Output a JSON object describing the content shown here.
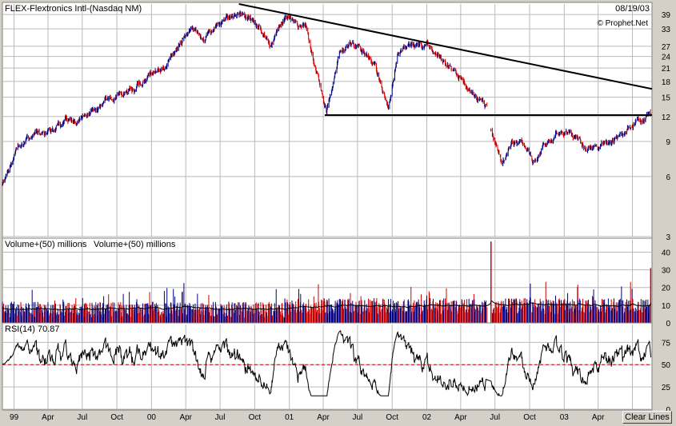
{
  "header": {
    "title": "FLEX-Flextronics Intl-(Nasdaq NM)",
    "date": "08/19/03",
    "watermark": "© Prophet.Net"
  },
  "buttons": {
    "clear_lines": "Clear Lines"
  },
  "colors": {
    "up": "#000080",
    "down": "#cc0000",
    "trendline": "#000000",
    "rsi_reference": "#cc0000",
    "panel_bg": "#ffffff",
    "frame": "#d4d0c8"
  },
  "chart_data": [
    {
      "type": "line",
      "name": "price",
      "title": "FLEX-Flextronics Intl-(Nasdaq NM)",
      "y_scale": "log",
      "yticks": [
        3,
        6,
        9,
        12,
        15,
        18,
        21,
        24,
        27,
        33,
        39
      ],
      "ylim": [
        3,
        44
      ],
      "xlim": [
        "1998-12-01",
        "2003-08-22"
      ],
      "x_ticks": [
        {
          "date": "1999-01-01",
          "label": "99"
        },
        {
          "date": "1999-04-01",
          "label": "Apr"
        },
        {
          "date": "1999-07-01",
          "label": "Jul"
        },
        {
          "date": "1999-10-01",
          "label": "Oct"
        },
        {
          "date": "2000-01-01",
          "label": "00"
        },
        {
          "date": "2000-04-01",
          "label": "Apr"
        },
        {
          "date": "2000-07-01",
          "label": "Jul"
        },
        {
          "date": "2000-10-01",
          "label": "Oct"
        },
        {
          "date": "2001-01-01",
          "label": "01"
        },
        {
          "date": "2001-04-01",
          "label": "Apr"
        },
        {
          "date": "2001-07-01",
          "label": "Jul"
        },
        {
          "date": "2001-10-01",
          "label": "Oct"
        },
        {
          "date": "2002-01-01",
          "label": "02"
        },
        {
          "date": "2002-04-01",
          "label": "Apr"
        },
        {
          "date": "2002-07-01",
          "label": "Jul"
        },
        {
          "date": "2002-10-01",
          "label": "Oct"
        },
        {
          "date": "2003-01-01",
          "label": "03"
        },
        {
          "date": "2003-04-01",
          "label": "Apr"
        },
        {
          "date": "2003-07-01",
          "label": "Jul"
        }
      ],
      "x": [
        "1998-12-01",
        "1999-01-15",
        "1999-03-01",
        "1999-04-15",
        "1999-05-15",
        "1999-06-15",
        "1999-08-01",
        "1999-09-15",
        "1999-11-01",
        "1999-12-15",
        "2000-01-15",
        "2000-03-01",
        "2000-04-15",
        "2000-05-15",
        "2000-07-01",
        "2000-08-20",
        "2000-09-15",
        "2000-10-15",
        "2000-11-15",
        "2000-12-15",
        "2001-01-15",
        "2001-02-15",
        "2001-03-20",
        "2001-04-10",
        "2001-05-15",
        "2001-06-15",
        "2001-07-15",
        "2001-08-15",
        "2001-09-20",
        "2001-10-15",
        "2001-11-15",
        "2001-12-15",
        "2002-01-15",
        "2002-02-15",
        "2002-03-15",
        "2002-04-15",
        "2002-05-15",
        "2002-06-10",
        "2002-06-20",
        "2002-07-20",
        "2002-08-15",
        "2002-09-15",
        "2002-10-10",
        "2002-11-15",
        "2002-12-15",
        "2003-01-15",
        "2003-02-15",
        "2003-03-15",
        "2003-04-15",
        "2003-05-15",
        "2003-06-15",
        "2003-07-15",
        "2003-08-19"
      ],
      "close": [
        5.5,
        8.5,
        9.5,
        10.5,
        11.5,
        11.5,
        13,
        15,
        16,
        19,
        20,
        25,
        33,
        29,
        35,
        40,
        37,
        33,
        27,
        37,
        35,
        33,
        18,
        13,
        26,
        27,
        25,
        22,
        13,
        25,
        27,
        27,
        26,
        23,
        21,
        18,
        15,
        13,
        10,
        7,
        9,
        9,
        7,
        9,
        10,
        10,
        9,
        8,
        8.5,
        9,
        10,
        11.5,
        12
      ]
    },
    {
      "type": "bar",
      "name": "volume",
      "title": "Volume+(50) millions",
      "legend": "Volume+(50) millions",
      "yticks": [
        0,
        10,
        20,
        30,
        40
      ],
      "ylim": [
        0,
        47
      ],
      "moving_average_level": 8,
      "notable_spikes": [
        {
          "date": "2002-06-20",
          "value": 46
        },
        {
          "date": "2003-08-19",
          "value": 31
        }
      ]
    },
    {
      "type": "line",
      "name": "rsi",
      "title": "RSI(14) 70.87",
      "yticks": [
        0,
        25,
        50,
        75
      ],
      "ylim": [
        0,
        95
      ],
      "reference_line": 50,
      "last_value": 70.87
    }
  ]
}
